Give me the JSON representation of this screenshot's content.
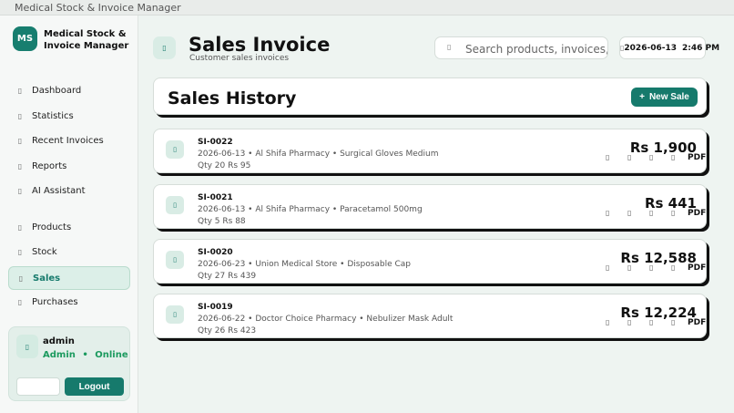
{
  "window": {
    "title": "Medical Stock & Invoice Manager"
  },
  "brand": {
    "logo_text": "MS",
    "name": "Medical Stock & Invoice Manager"
  },
  "sidebar": {
    "items": [
      {
        "label": "Dashboard",
        "icon": "dashboard-icon"
      },
      {
        "label": "Statistics",
        "icon": "statistics-icon"
      },
      {
        "label": "Recent Invoices",
        "icon": "invoices-icon"
      },
      {
        "label": "Reports",
        "icon": "reports-icon"
      },
      {
        "label": "AI Assistant",
        "icon": "assistant-icon"
      },
      {
        "label": "Products",
        "icon": "products-icon"
      },
      {
        "label": "Stock",
        "icon": "stock-icon"
      },
      {
        "label": "Sales",
        "icon": "sales-icon",
        "active": true
      },
      {
        "label": "Purchases",
        "icon": "purchases-icon"
      }
    ]
  },
  "user": {
    "name": "admin",
    "role": "Admin",
    "separator": "•",
    "status": "Online",
    "logout_label": "Logout"
  },
  "header": {
    "title": "Sales Invoice",
    "subtitle": "Customer sales invoices",
    "search_placeholder": "Search products, invoices, customers",
    "date": "2026-06-13",
    "time": "2:46 PM"
  },
  "history": {
    "title": "Sales History",
    "new_sale_plus": "+",
    "new_sale_label": "New Sale"
  },
  "invoices": [
    {
      "id": "SI-0022",
      "desc": "2026-06-13 • Al Shifa Pharmacy • Surgical Gloves Medium",
      "qty": "Qty 20 Rs 95",
      "amount": "Rs 1,900",
      "pdf": "PDF"
    },
    {
      "id": "SI-0021",
      "desc": "2026-06-13 • Al Shifa Pharmacy • Paracetamol 500mg",
      "qty": "Qty 5 Rs 88",
      "amount": "Rs 441",
      "pdf": "PDF"
    },
    {
      "id": "SI-0020",
      "desc": "2026-06-23 • Union Medical Store • Disposable Cap",
      "qty": "Qty 27 Rs 439",
      "amount": "Rs 12,588",
      "pdf": "PDF"
    },
    {
      "id": "SI-0019",
      "desc": "2026-06-22 • Doctor Choice Pharmacy • Nebulizer Mask Adult",
      "qty": "Qty 26 Rs 423",
      "amount": "Rs 12,224",
      "pdf": "PDF"
    }
  ],
  "icons": {
    "glyph": "▯"
  },
  "colors": {
    "accent": "#167a6c",
    "online": "#1b9a5e",
    "active_bg": "#dcefe8"
  }
}
